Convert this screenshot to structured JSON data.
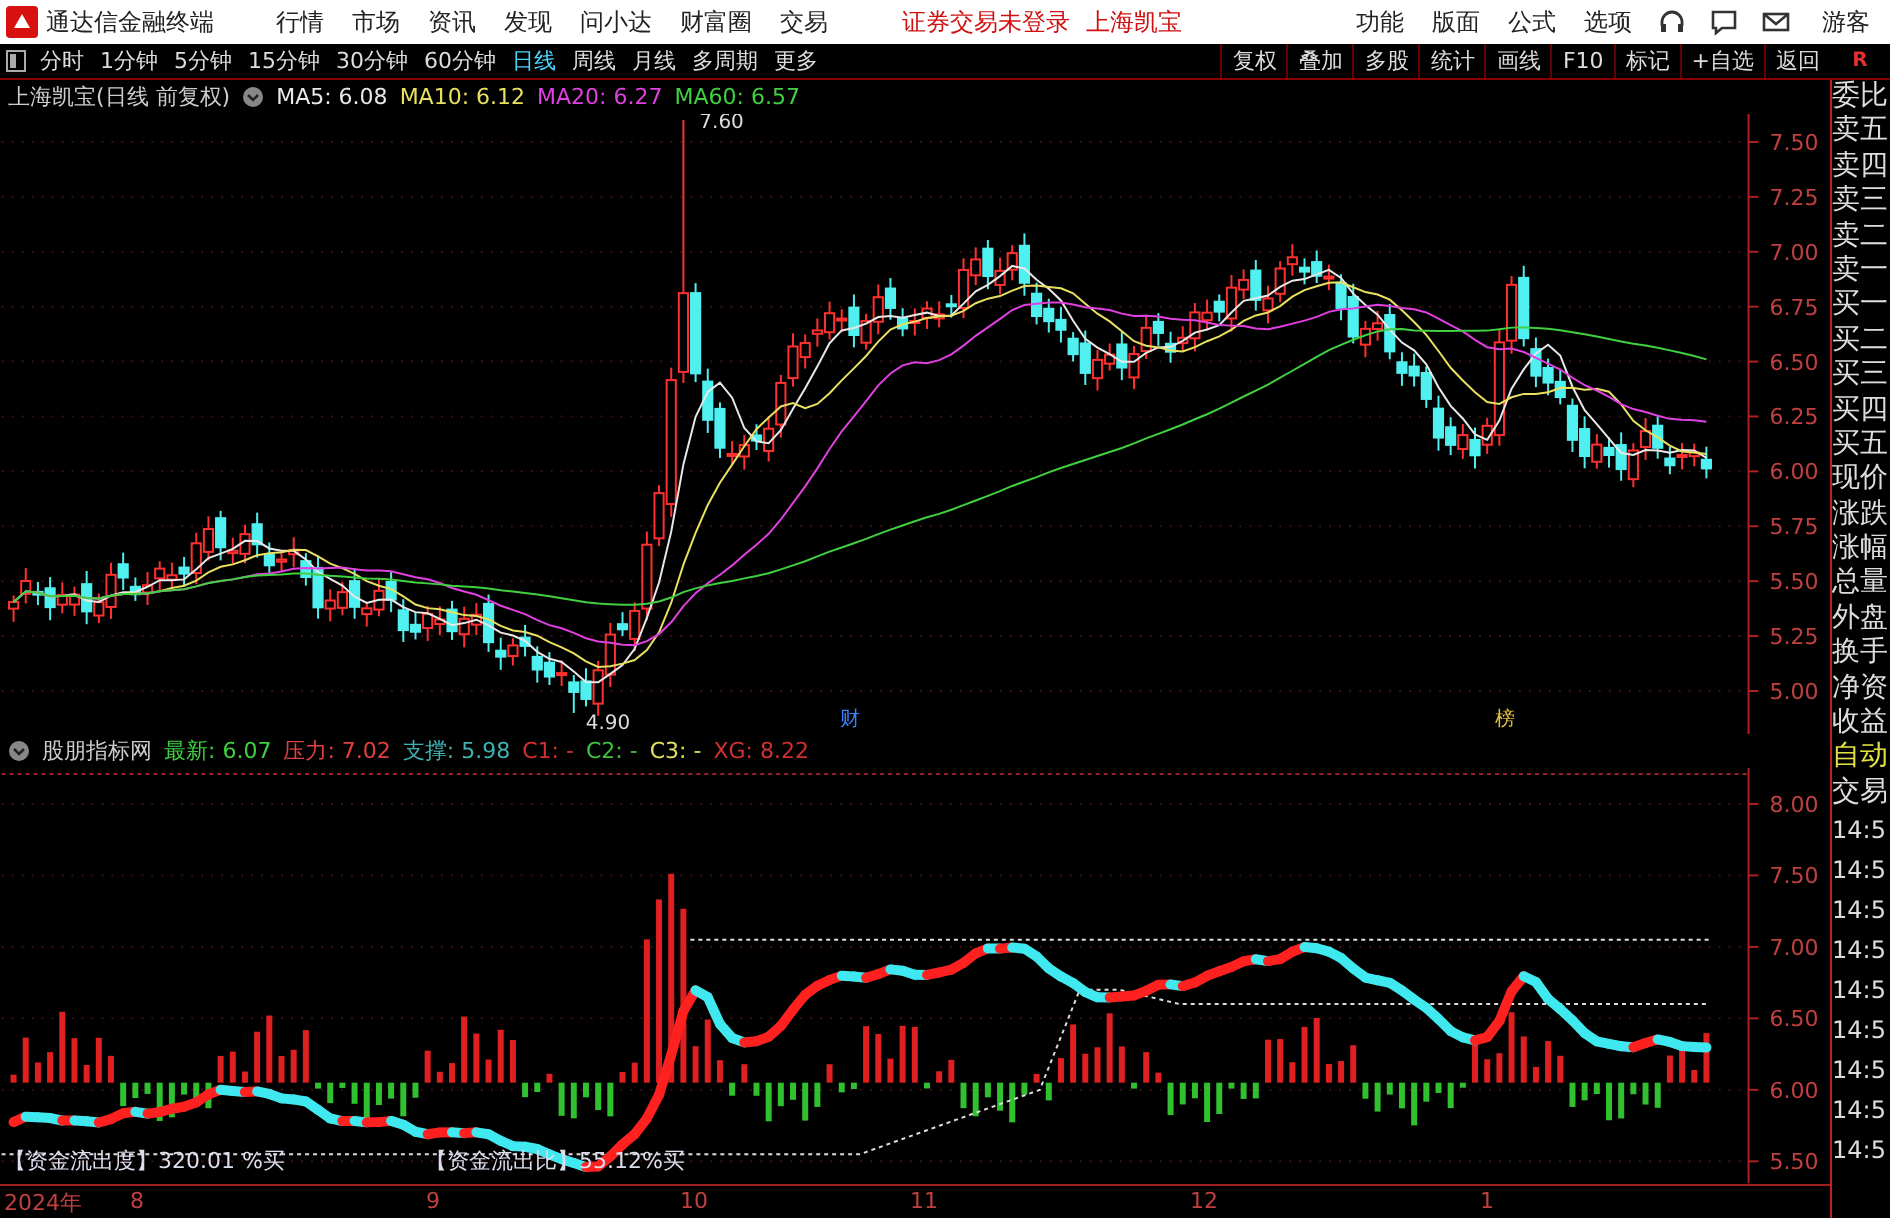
{
  "app_title": "通达信金融终端",
  "menu": [
    "行情",
    "市场",
    "资讯",
    "发现",
    "问小达",
    "财富圈",
    "交易"
  ],
  "login_notice": "证券交易未登录",
  "stock_link": "上海凯宝",
  "top_right_menu": [
    "功能",
    "版面",
    "公式",
    "选项"
  ],
  "user": "游客",
  "periods": [
    {
      "label": "分时",
      "selected": false
    },
    {
      "label": "1分钟",
      "selected": false
    },
    {
      "label": "5分钟",
      "selected": false
    },
    {
      "label": "15分钟",
      "selected": false
    },
    {
      "label": "30分钟",
      "selected": false
    },
    {
      "label": "60分钟",
      "selected": false
    },
    {
      "label": "日线",
      "selected": true
    },
    {
      "label": "周线",
      "selected": false
    },
    {
      "label": "月线",
      "selected": false
    },
    {
      "label": "多周期",
      "selected": false
    },
    {
      "label": "更多",
      "selected": false
    }
  ],
  "tools": [
    "复权",
    "叠加",
    "多股",
    "统计",
    "画线",
    "F10",
    "标记",
    "+自选",
    "返回"
  ],
  "corner_label": "R",
  "price_chart": {
    "title": "上海凯宝(日线 前复权)",
    "ma": [
      {
        "label": "MA5: 6.08",
        "color": "#e8e8e8"
      },
      {
        "label": "MA10: 6.12",
        "color": "#e8e060"
      },
      {
        "label": "MA20: 6.27",
        "color": "#e040e0"
      },
      {
        "label": "MA60: 6.57",
        "color": "#40d040"
      }
    ],
    "yticks": [
      "7.50",
      "7.25",
      "7.00",
      "6.75",
      "6.50",
      "6.25",
      "6.00",
      "5.75",
      "5.50",
      "5.25",
      "5.00"
    ],
    "high_label": "7.60",
    "low_label": "4.90",
    "event_markers": [
      {
        "label": "财",
        "color": "#4080ff"
      },
      {
        "label": "榜",
        "color": "#e0c040"
      }
    ]
  },
  "indicator": {
    "name": "股朋指标网",
    "items": [
      {
        "label": "最新: 6.07",
        "color": "#40d040"
      },
      {
        "label": "压力: 7.02",
        "color": "#e04040"
      },
      {
        "label": "支撑: 5.98",
        "color": "#40b0b0"
      },
      {
        "label": "C1: -",
        "color": "#d03030"
      },
      {
        "label": "C2: -",
        "color": "#40c040"
      },
      {
        "label": "C3: -",
        "color": "#e0e060"
      },
      {
        "label": "XG: 8.22",
        "color": "#d03030"
      }
    ],
    "yticks": [
      "8.00",
      "7.50",
      "7.00",
      "6.50",
      "6.00",
      "5.50"
    ],
    "notes": [
      "【资金流出度】320.01 %买",
      "【资金流出比】55.12%买"
    ]
  },
  "date_axis": [
    "2024年",
    "8",
    "9",
    "10",
    "11",
    "12",
    "1"
  ],
  "side_panel": {
    "labels": [
      "委比",
      "卖五",
      "卖四",
      "卖三",
      "卖二",
      "卖一",
      "买一",
      "买二",
      "买三",
      "买四",
      "买五",
      "现价",
      "涨跌",
      "涨幅",
      "总量",
      "外盘",
      "换手",
      "净资",
      "收益"
    ],
    "mode": "自动",
    "trade": "交易",
    "times": [
      "14:5",
      "14:5",
      "14:5",
      "14:5",
      "14:5",
      "14:5",
      "14:5",
      "14:5",
      "14:5"
    ]
  }
}
